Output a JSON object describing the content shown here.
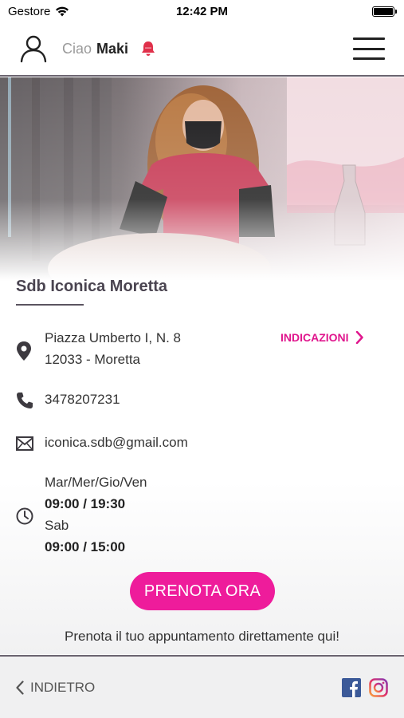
{
  "status_bar": {
    "carrier": "Gestore",
    "time": "12:42 PM"
  },
  "header": {
    "greeting": "Ciao",
    "user_name": "Maki"
  },
  "salon": {
    "name": "Sdb Iconica Moretta",
    "address_line1": "Piazza Umberto I, N. 8",
    "address_line2": "12033 - Moretta",
    "directions_label": "INDICAZIONI",
    "phone": "3478207231",
    "email": "iconica.sdb@gmail.com",
    "hours": [
      {
        "days": "Mar/Mer/Gio/Ven",
        "time": "09:00 / 19:30"
      },
      {
        "days": "Sab",
        "time": "09:00 / 15:00"
      }
    ]
  },
  "booking": {
    "button_label": "PRENOTA ORA",
    "caption": "Prenota il tuo appuntamento direttamente qui!"
  },
  "footer": {
    "back_label": "INDIETRO"
  },
  "colors": {
    "accent": "#ee1c9b",
    "bell": "#e0304a",
    "facebook": "#3b5998"
  }
}
